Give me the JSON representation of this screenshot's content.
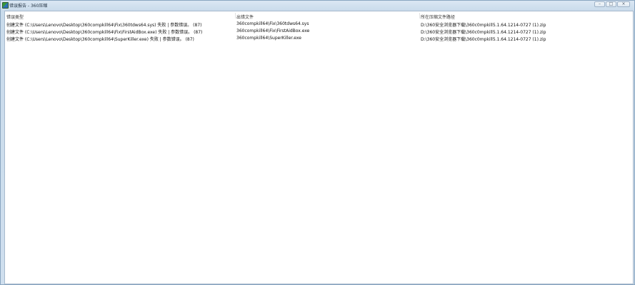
{
  "window": {
    "title": "错误报告 - 360压缩",
    "minimize": "–",
    "maximize": "□",
    "close": "×"
  },
  "table": {
    "columns": [
      "错误类型",
      "出错文件",
      "所在压缩文件路径"
    ],
    "rows": [
      {
        "error": "创建文件 (C:\\Users\\Lenovo\\Desktop\\360compkill64\\Fix\\360tdws64.sys) 失败 | 参数错误。 (87)",
        "file": "360compkill64\\Fix\\360tdws64.sys",
        "path": "D:\\360安全浏览器下载\\360c0mpkill5.1.64.1214-0727 (1).zip"
      },
      {
        "error": "创建文件 (C:\\Users\\Lenovo\\Desktop\\360compkill64\\Fix\\FirstAidBox.exe) 失败 | 参数错误。 (87)",
        "file": "360compkill64\\Fix\\FirstAidBox.exe",
        "path": "D:\\360安全浏览器下载\\360c0mpkill5.1.64.1214-0727 (1).zip"
      },
      {
        "error": "创建文件 (C:\\Users\\Lenovo\\Desktop\\360compkill64\\SuperKiller.exe) 失败 | 参数错误。 (87)",
        "file": "360compkill64\\SuperKiller.exe",
        "path": "D:\\360安全浏览器下载\\360c0mpkill5.1.64.1214-0727 (1).zip"
      }
    ]
  }
}
